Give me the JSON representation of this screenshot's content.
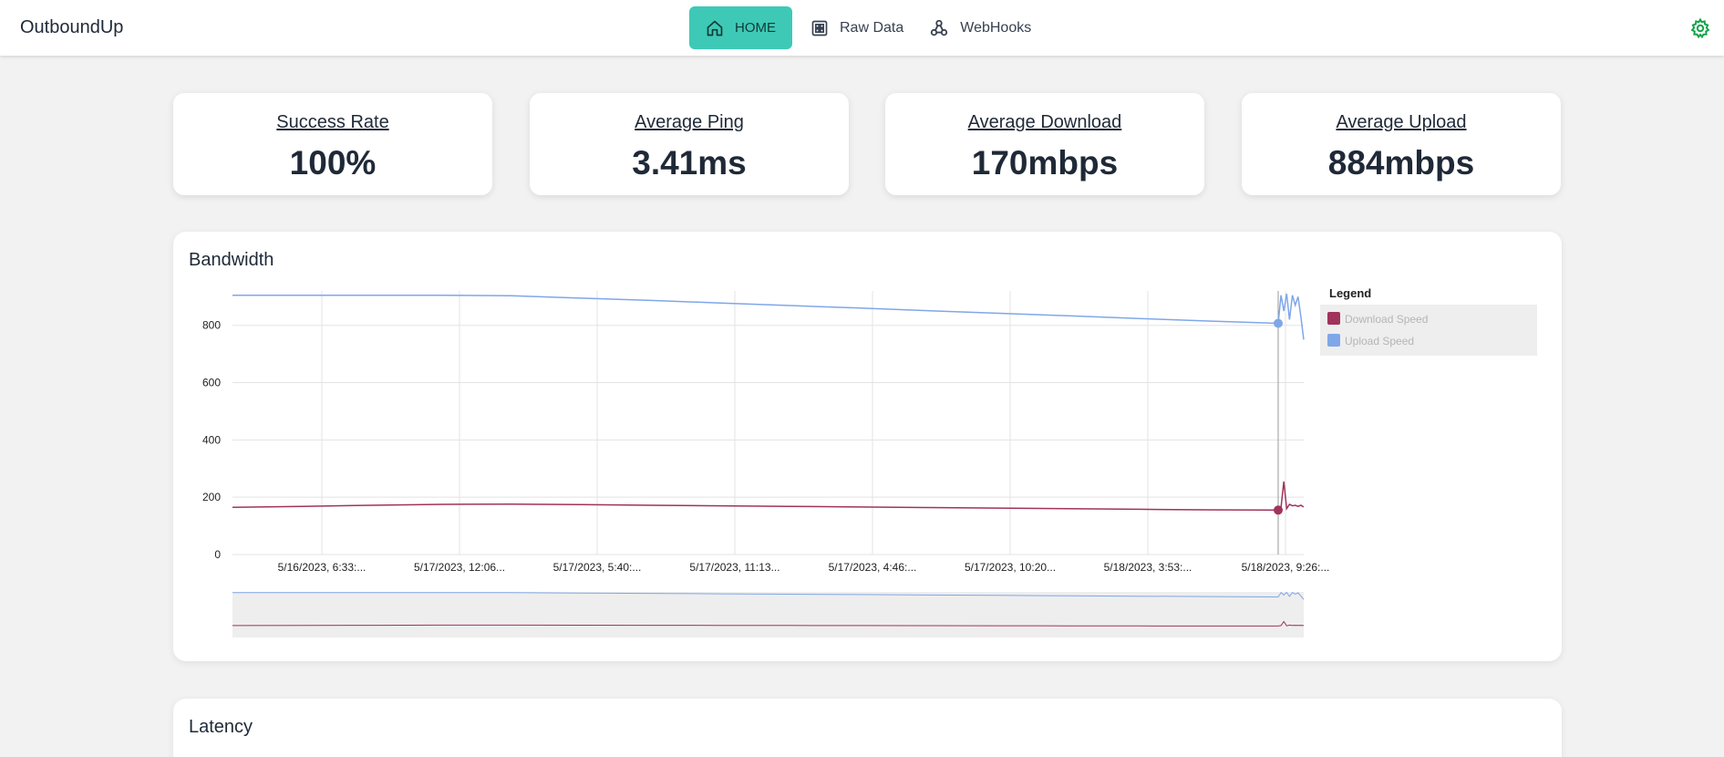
{
  "app": {
    "brand": "OutboundUp"
  },
  "nav": {
    "home": "HOME",
    "raw_data": "Raw Data",
    "webhooks": "WebHooks"
  },
  "stats": [
    {
      "label": "Success Rate",
      "value": "100%"
    },
    {
      "label": "Average Ping",
      "value": "3.41ms"
    },
    {
      "label": "Average Download",
      "value": "170mbps"
    },
    {
      "label": "Average Upload",
      "value": "884mbps"
    }
  ],
  "bandwidth": {
    "title": "Bandwidth",
    "legend_title": "Legend",
    "legend": [
      "Download Speed",
      "Upload Speed"
    ]
  },
  "latency": {
    "title": "Latency"
  },
  "colors": {
    "accent": "#3ec9b6",
    "download": "#a0335b",
    "upload": "#7fa7e8",
    "gear": "#16a34a"
  },
  "icons": {
    "home": "home-icon",
    "raw_data": "grid-icon",
    "webhooks": "webhook-icon",
    "settings": "gear-icon"
  },
  "chart_data": {
    "type": "line",
    "title": "Bandwidth",
    "ylim": [
      0,
      920
    ],
    "yticks": [
      0,
      200,
      400,
      600,
      800
    ],
    "x_tick_labels": [
      "5/16/2023, 6:33:...",
      "5/17/2023, 12:06...",
      "5/17/2023, 5:40:...",
      "5/17/2023, 11:13...",
      "5/17/2023, 4:46:...",
      "5/17/2023, 10:20...",
      "5/18/2023, 3:53:...",
      "5/18/2023, 9:26:..."
    ],
    "grid": true,
    "legend_position": "right",
    "series": [
      {
        "name": "Download Speed",
        "color": "#a0335b",
        "values": [
          165,
          168,
          172,
          175,
          176,
          174,
          172,
          170,
          168,
          166,
          164,
          162,
          160,
          158,
          156,
          155,
          165,
          255,
          160,
          175,
          170,
          172,
          168,
          172,
          166
        ]
      },
      {
        "name": "Upload Speed",
        "color": "#7fa7e8",
        "values": [
          905,
          905,
          905,
          905,
          903,
          895,
          887,
          878,
          869,
          860,
          851,
          842,
          833,
          824,
          815,
          807,
          905,
          850,
          910,
          820,
          905,
          870,
          900,
          830,
          750
        ]
      }
    ]
  }
}
